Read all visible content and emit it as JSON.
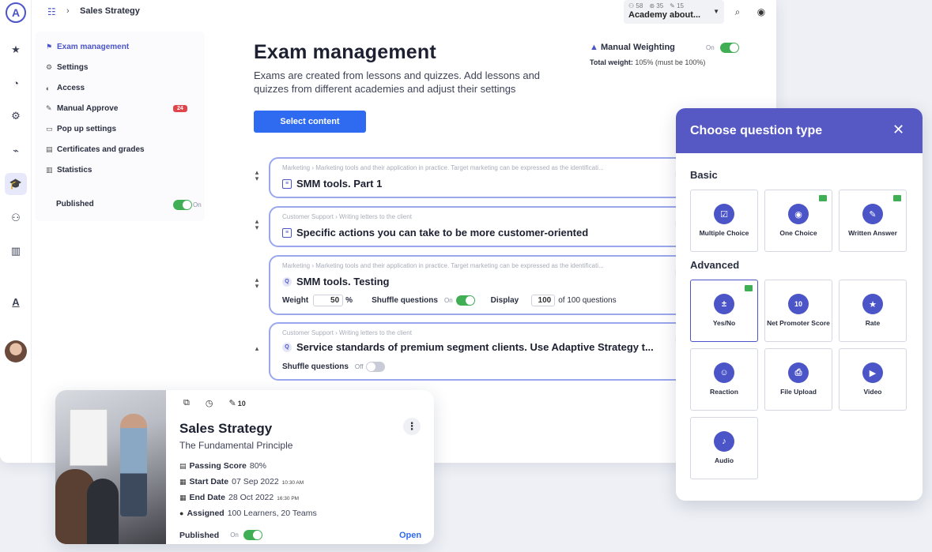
{
  "topbar": {
    "breadcrumb_title": "Sales Strategy",
    "academy": {
      "stats": [
        "58",
        "35",
        "15"
      ],
      "name": "Academy about..."
    }
  },
  "subnav": {
    "items": [
      {
        "label": "Exam management",
        "icon": "exam-icon",
        "active": true
      },
      {
        "label": "Settings",
        "icon": "gear-icon"
      },
      {
        "label": "Access",
        "icon": "access-icon"
      },
      {
        "label": "Manual Approve",
        "icon": "pencil-icon",
        "badge": "24"
      },
      {
        "label": "Pop up settings",
        "icon": "popup-icon"
      },
      {
        "label": "Certificates and grades",
        "icon": "certificate-icon"
      },
      {
        "label": "Statistics",
        "icon": "chart-icon"
      }
    ],
    "published_label": "Published",
    "published_state": "On"
  },
  "header": {
    "title": "Exam management",
    "subtitle": "Exams are created from lessons and quizzes. Add lessons and quizzes from different academies and adjust their settings",
    "select_button": "Select content"
  },
  "weighting": {
    "label": "Manual Weighting",
    "state": "On",
    "total_label": "Total weight:",
    "total_value": "105% (must be 100%)"
  },
  "cards": [
    {
      "path": "Marketing › Marketing tools and their application in practice. Target marketing can be expressed as the identificati...",
      "title": "SMM tools. Part 1",
      "type": "lesson"
    },
    {
      "path": "Customer Support › Writing letters to the client",
      "title": "Specific actions you can take to be more customer-oriented",
      "type": "lesson"
    },
    {
      "path": "Marketing › Marketing tools and their application in practice. Target marketing can be expressed as the identificati...",
      "title": "SMM tools. Testing",
      "type": "quiz",
      "weight_label": "Weight",
      "weight_value": "50",
      "weight_unit": "%",
      "shuffle_label": "Shuffle questions",
      "shuffle_state": "On",
      "display_label": "Display",
      "display_value": "100",
      "display_suffix": "of 100 questions"
    },
    {
      "path": "Customer Support › Writing letters to the client",
      "title": "Service standards of premium segment clients. Use Adaptive Strategy t...",
      "type": "quiz",
      "shuffle_label": "Shuffle questions",
      "shuffle_state": "Off"
    }
  ],
  "question_panel": {
    "title": "Choose question type",
    "basic_label": "Basic",
    "advanced_label": "Advanced",
    "basic": [
      {
        "label": "Multiple Choice",
        "icon": "checkbox-icon",
        "glyph": "☑"
      },
      {
        "label": "One Choice",
        "icon": "radio-icon",
        "glyph": "◉"
      },
      {
        "label": "Written Answer",
        "icon": "write-icon",
        "glyph": "✎"
      }
    ],
    "advanced": [
      {
        "label": "Yes/No",
        "icon": "plus-minus-icon",
        "glyph": "±"
      },
      {
        "label": "Net Promoter Score",
        "icon": "nps-icon",
        "glyph": "10"
      },
      {
        "label": "Rate",
        "icon": "star-icon",
        "glyph": "★"
      },
      {
        "label": "Reaction",
        "icon": "smile-icon",
        "glyph": "☺"
      },
      {
        "label": "File Upload",
        "icon": "file-icon",
        "glyph": "⎙"
      },
      {
        "label": "Video",
        "icon": "video-icon",
        "glyph": "▶"
      },
      {
        "label": "Audio",
        "icon": "audio-icon",
        "glyph": "♪"
      }
    ]
  },
  "sales_card": {
    "title": "Sales Strategy",
    "subtitle": "The Fundamental Principle",
    "edit_count": "10",
    "passing_label": "Passing Score",
    "passing_value": "80%",
    "start_label": "Start Date",
    "start_date": "07 Sep 2022",
    "start_time": "10:30 AM",
    "end_label": "End Date",
    "end_date": "28 Oct 2022",
    "end_time": "16:30 PM",
    "assigned_label": "Assigned",
    "assigned_value": "100 Learners, 20 Teams",
    "published_label": "Published",
    "published_state": "On",
    "open_label": "Open"
  },
  "colors": {
    "accent": "#4b55c8",
    "primary_button": "#2f6bf0",
    "toggle_on": "#3fae54",
    "panel_header": "#5658c4"
  }
}
